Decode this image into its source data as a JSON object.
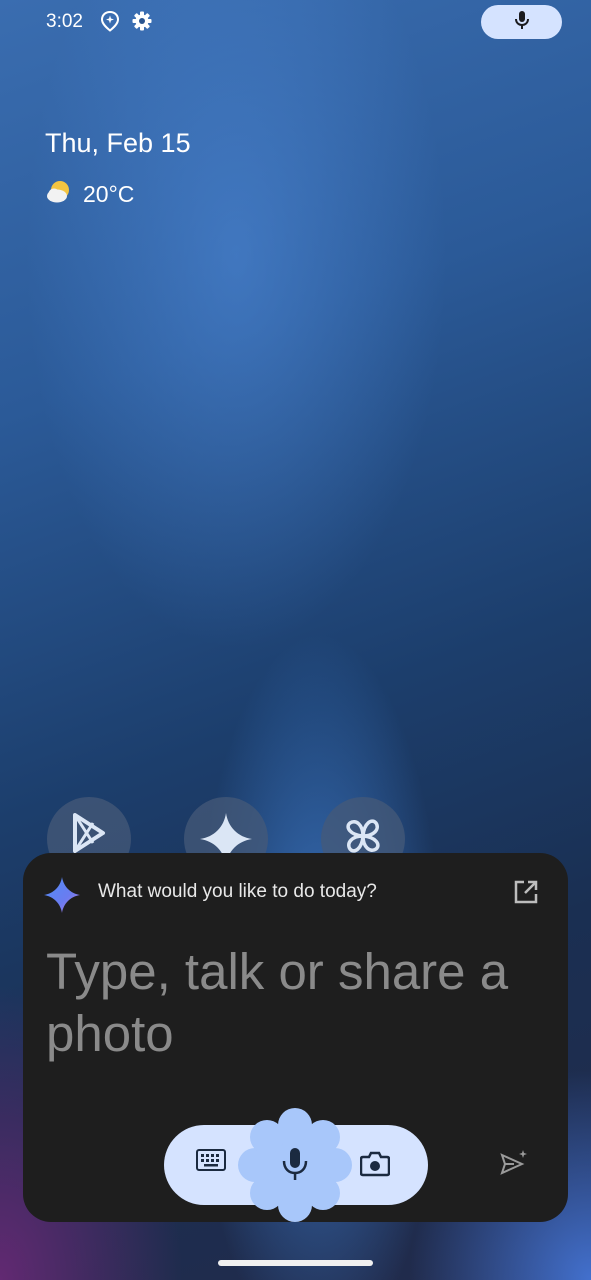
{
  "status_bar": {
    "time": "3:02",
    "icons": [
      "assistant-location-icon",
      "gear-icon"
    ],
    "voice_button_icon": "mic-icon"
  },
  "home": {
    "date": "Thu, Feb 15",
    "weather": {
      "icon": "partly-sunny-icon",
      "temperature": "20°C"
    },
    "apps": [
      "play-store-icon",
      "gemini-icon",
      "pinwheel-icon"
    ]
  },
  "assistant": {
    "prompt": "What would you like to do today?",
    "input_placeholder": "Type, talk or share a photo",
    "actions": [
      "keyboard-icon",
      "mic-icon",
      "camera-icon",
      "send-icon",
      "open-external-icon"
    ],
    "accent_color": "#d5e3ff",
    "mic_blob_color": "#a8c7fa"
  }
}
